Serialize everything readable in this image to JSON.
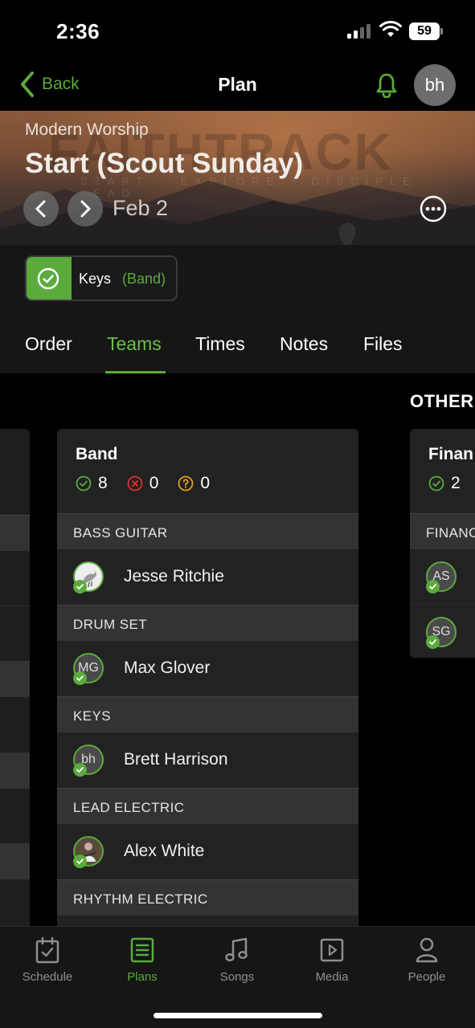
{
  "status_bar": {
    "time": "2:36",
    "battery": "59"
  },
  "nav": {
    "back_label": "Back",
    "title": "Plan",
    "user_initials": "bh"
  },
  "hero": {
    "service_type": "Modern Worship",
    "plan_title": "Start (Scout Sunday)",
    "date": "Feb 2",
    "watermark": "FAITHTRACK",
    "watermark_tagline": "START · EXPLORE · DISCIPLE · LEAD"
  },
  "position_chip": {
    "position": "Keys",
    "team": "(Band)"
  },
  "tabs": [
    {
      "label": "Order"
    },
    {
      "label": "Teams"
    },
    {
      "label": "Times"
    },
    {
      "label": "Notes"
    },
    {
      "label": "Files"
    }
  ],
  "active_tab": "Teams",
  "other_heading": "OTHER",
  "band_card": {
    "title": "Band",
    "stats": {
      "confirmed": "8",
      "declined": "0",
      "pending": "0"
    },
    "sections": [
      {
        "position": "BASS GUITAR",
        "people": [
          {
            "name": "Jesse Ritchie",
            "initials": ""
          }
        ]
      },
      {
        "position": "DRUM SET",
        "people": [
          {
            "name": "Max Glover",
            "initials": "MG"
          }
        ]
      },
      {
        "position": "KEYS",
        "people": [
          {
            "name": "Brett Harrison",
            "initials": "bh"
          }
        ]
      },
      {
        "position": "LEAD ELECTRIC",
        "people": [
          {
            "name": "Alex White",
            "initials": ""
          }
        ]
      },
      {
        "position": "RHYTHM ELECTRIC",
        "people": []
      }
    ]
  },
  "finance_card": {
    "title": "Finan",
    "stats": {
      "confirmed": "2"
    },
    "section": "FINANC",
    "people": [
      {
        "initials": "AS"
      },
      {
        "initials": "SG"
      }
    ]
  },
  "tab_bar": [
    {
      "label": "Schedule",
      "icon": "calendar-check-icon"
    },
    {
      "label": "Plans",
      "icon": "list-doc-icon"
    },
    {
      "label": "Songs",
      "icon": "music-note-icon"
    },
    {
      "label": "Media",
      "icon": "play-box-icon"
    },
    {
      "label": "People",
      "icon": "person-icon"
    }
  ],
  "colors": {
    "accent": "#5aab3c",
    "declined": "#d9342b",
    "pending": "#e0a020"
  }
}
